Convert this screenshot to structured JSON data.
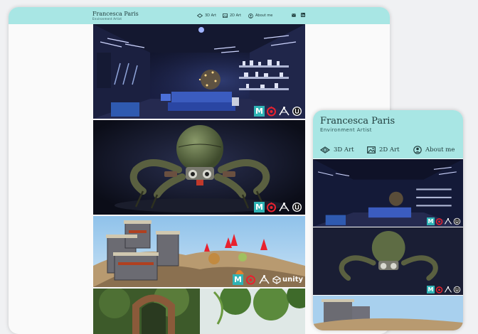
{
  "desktop": {
    "header": {
      "name": "Francesca Paris",
      "subtitle": "Environment Artist",
      "nav": [
        {
          "label": "3D Art",
          "icon": "cube-icon"
        },
        {
          "label": "2D Art",
          "icon": "image-icon"
        },
        {
          "label": "About me",
          "icon": "user-circle-icon"
        }
      ],
      "social_icons": [
        "mail-icon",
        "linkedin-icon"
      ]
    },
    "portfolio": [
      {
        "name": "bedroom-scene",
        "tools": [
          "maya",
          "substance",
          "zbrush",
          "unreal"
        ]
      },
      {
        "name": "robot-spider",
        "tools": [
          "maya",
          "substance",
          "zbrush",
          "unreal"
        ]
      },
      {
        "name": "fortress-island",
        "tools": [
          "maya",
          "substance",
          "zbrush",
          "unity"
        ],
        "engine_label": "unity"
      },
      {
        "name": "jungle-gate",
        "tools": []
      }
    ]
  },
  "mobile": {
    "header": {
      "name": "Francesca Paris",
      "subtitle": "Environment Artist",
      "nav": [
        {
          "label": "3D Art",
          "icon": "cube-icon"
        },
        {
          "label": "2D Art",
          "icon": "image-icon"
        },
        {
          "label": "About me",
          "icon": "user-circle-icon"
        }
      ]
    },
    "portfolio": [
      {
        "name": "bedroom-scene",
        "tools": [
          "maya",
          "substance",
          "zbrush",
          "unreal"
        ]
      },
      {
        "name": "robot-spider",
        "tools": [
          "maya",
          "substance",
          "zbrush",
          "unreal"
        ]
      },
      {
        "name": "fortress-island",
        "tools": []
      }
    ]
  },
  "colors": {
    "header_bg": "#a8e6e4",
    "header_text": "#1e3a3a",
    "page_bg": "#f0f1f3",
    "card_bg": "#fafafa",
    "maya_badge": "#2fb3b5",
    "substance_red": "#e8212e"
  }
}
